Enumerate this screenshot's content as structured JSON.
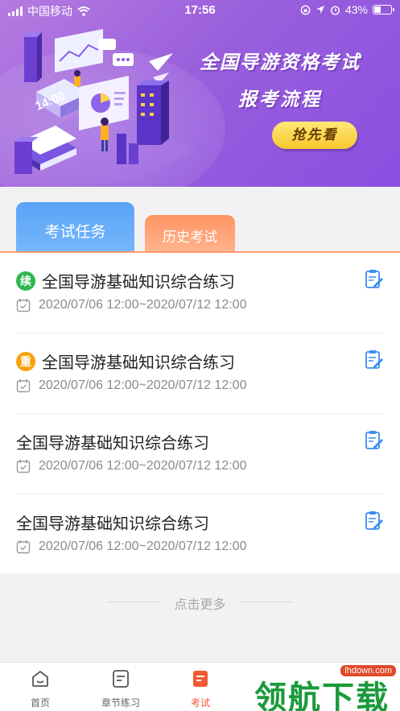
{
  "status_bar": {
    "carrier": "中国移动",
    "time": "17:56",
    "battery": "43%",
    "battery_level": 0.43
  },
  "banner": {
    "title_line1": "全国导游资格考试",
    "title_line2": "报考流程",
    "cta_label": "抢先看",
    "illustration_clock": "14:00"
  },
  "tabs": {
    "active_label": "考试任务",
    "inactive_label": "历史考试"
  },
  "exams": [
    {
      "badge": "续",
      "title": "全国导游基础知识综合练习",
      "date": "2020/07/06 12:00~2020/07/12 12:00"
    },
    {
      "badge": "重",
      "title": "全国导游基础知识综合练习",
      "date": "2020/07/06 12:00~2020/07/12 12:00"
    },
    {
      "badge": "",
      "title": "全国导游基础知识综合练习",
      "date": "2020/07/06 12:00~2020/07/12 12:00"
    },
    {
      "badge": "",
      "title": "全国导游基础知识综合练习",
      "date": "2020/07/06 12:00~2020/07/12 12:00"
    }
  ],
  "more_label": "点击更多",
  "bottom_nav": {
    "items": [
      {
        "label": "首页",
        "icon": "home-icon"
      },
      {
        "label": "章节练习",
        "icon": "chapter-icon"
      },
      {
        "label": "考试",
        "icon": "exam-icon"
      },
      {
        "label": "",
        "icon": ""
      },
      {
        "label": "",
        "icon": ""
      }
    ],
    "active_index": 2
  },
  "watermark": {
    "text": "领航下载",
    "site": "lhdown.com"
  },
  "colors": {
    "banner_purple": "#9a5fdc",
    "tab_blue": "#5aa3f7",
    "tab_orange": "#ff9463",
    "active_nav": "#f05a34",
    "badge_green": "#2eb84f",
    "badge_orange": "#f5a20d",
    "edit_icon_blue": "#3a8ef0"
  }
}
